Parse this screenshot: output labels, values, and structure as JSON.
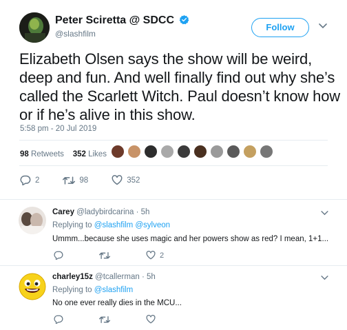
{
  "tweet": {
    "display_name": "Peter Sciretta @ SDCC",
    "handle": "@slashfilm",
    "follow_label": "Follow",
    "text": "Elizabeth Olsen says the show will be weird, deep and fun. And well finally find out why she’s called the Scarlett Witch. Paul doesn’t know how or if he’s alive in this show.",
    "timestamp": "5:58 pm - 20 Jul 2019",
    "retweets_count": "98",
    "retweets_label": "Retweets",
    "likes_count": "352",
    "likes_label": "Likes",
    "reply_count": "2",
    "retweet_count_action": "98",
    "like_count_action": "352",
    "liker_colors": [
      "#6d3a2a",
      "#c89368",
      "#2d2d2d",
      "#a9a9a9",
      "#3b3b3b",
      "#4a3020",
      "#9a9a9a",
      "#5a5a5a",
      "#c4a060",
      "#777777"
    ]
  },
  "replies": [
    {
      "name": "Carey",
      "meta": "@ladybirdcarina · 5h",
      "replying_prefix": "Replying to",
      "mentions": [
        "@slashfilm",
        "@sylveon"
      ],
      "text": "Ummm...because she uses magic and her powers show as red? I mean, 1+1...",
      "reply_count": "",
      "retweet_count": "",
      "like_count": "2"
    },
    {
      "name": "charley15z",
      "meta": "@tcallerman · 5h",
      "replying_prefix": "Replying to",
      "mentions": [
        "@slashfilm"
      ],
      "text": "No one ever really dies in the MCU...",
      "reply_count": "",
      "retweet_count": "",
      "like_count": ""
    }
  ],
  "colors": {
    "accent": "#1da1f2",
    "muted": "#657786",
    "divider": "#e6ecf0"
  }
}
